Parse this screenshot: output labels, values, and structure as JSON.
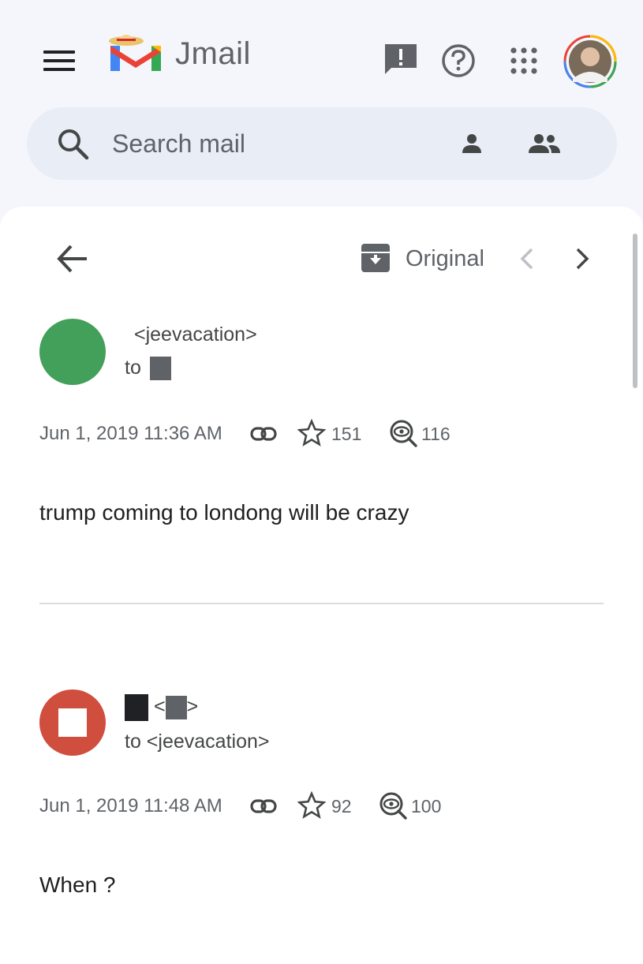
{
  "app": {
    "title": "Jmail"
  },
  "search": {
    "placeholder": "Search mail"
  },
  "toolbar": {
    "original_label": "Original"
  },
  "messages": [
    {
      "from": "<jeevacation>",
      "to_prefix": "to",
      "date": "Jun 1, 2019 11:36 AM",
      "stars": "151",
      "views": "116",
      "body": "trump coming to londong will be crazy",
      "avatar_color": "#43a05a"
    },
    {
      "from_open": "<",
      "from_close": ">",
      "to": "to <jeevacation>",
      "date": "Jun 1, 2019 11:48 AM",
      "stars": "92",
      "views": "100",
      "body": "When ?",
      "avatar_color": "#d04e3e"
    }
  ],
  "colors": {
    "icon": "#5f6368",
    "search_bg": "#e8edf6",
    "page_bg": "#f4f6fb"
  },
  "icons": [
    "menu-icon",
    "jmail-logo",
    "feedback-icon",
    "help-icon",
    "apps-grid-icon",
    "search-icon",
    "person-icon",
    "people-icon",
    "back-arrow-icon",
    "archive-icon",
    "chevron-left-icon",
    "chevron-right-icon",
    "link-icon",
    "star-icon",
    "views-icon"
  ]
}
